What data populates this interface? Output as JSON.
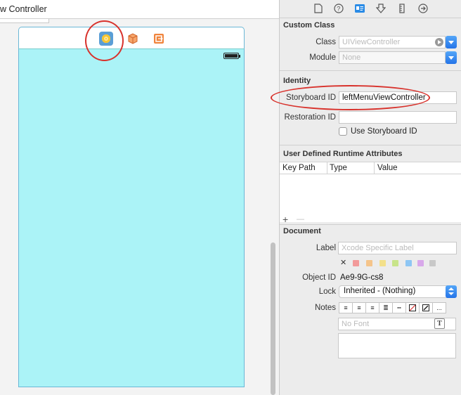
{
  "canvas": {
    "title": "w Controller",
    "scene_icons": [
      "view-controller-icon",
      "first-responder-icon",
      "exit-icon"
    ]
  },
  "inspector": {
    "tabs": [
      "file-icon",
      "help-icon",
      "identity-icon",
      "attributes-icon",
      "size-icon",
      "connections-icon"
    ],
    "custom_class": {
      "heading": "Custom Class",
      "class_label": "Class",
      "class_placeholder": "UIViewController",
      "module_label": "Module",
      "module_placeholder": "None"
    },
    "identity": {
      "heading": "Identity",
      "storyboard_id_label": "Storyboard ID",
      "storyboard_id_value": "leftMenuViewController",
      "restoration_id_label": "Restoration ID",
      "restoration_id_value": "",
      "use_storyboard_id_label": "Use Storyboard ID"
    },
    "runtime_attributes": {
      "heading": "User Defined Runtime Attributes",
      "columns": [
        "Key Path",
        "Type",
        "Value"
      ],
      "add": "+",
      "remove": "—"
    },
    "document": {
      "heading": "Document",
      "label_label": "Label",
      "label_placeholder": "Xcode Specific Label",
      "clear_glyph": "✕",
      "label_colors": [
        "#f29a9a",
        "#f5c48a",
        "#f3e08a",
        "#c8e48a",
        "#8ec6f4",
        "#d8a8ea",
        "#c8c8c8"
      ],
      "object_id_label": "Object ID",
      "object_id_value": "Ae9-9G-cs8",
      "lock_label": "Lock",
      "lock_value": "Inherited - (Nothing)",
      "notes_label": "Notes",
      "font_placeholder": "No Font",
      "more_glyph": "..."
    }
  },
  "accent": "#2474e8",
  "annotation_color": "#d8322c"
}
